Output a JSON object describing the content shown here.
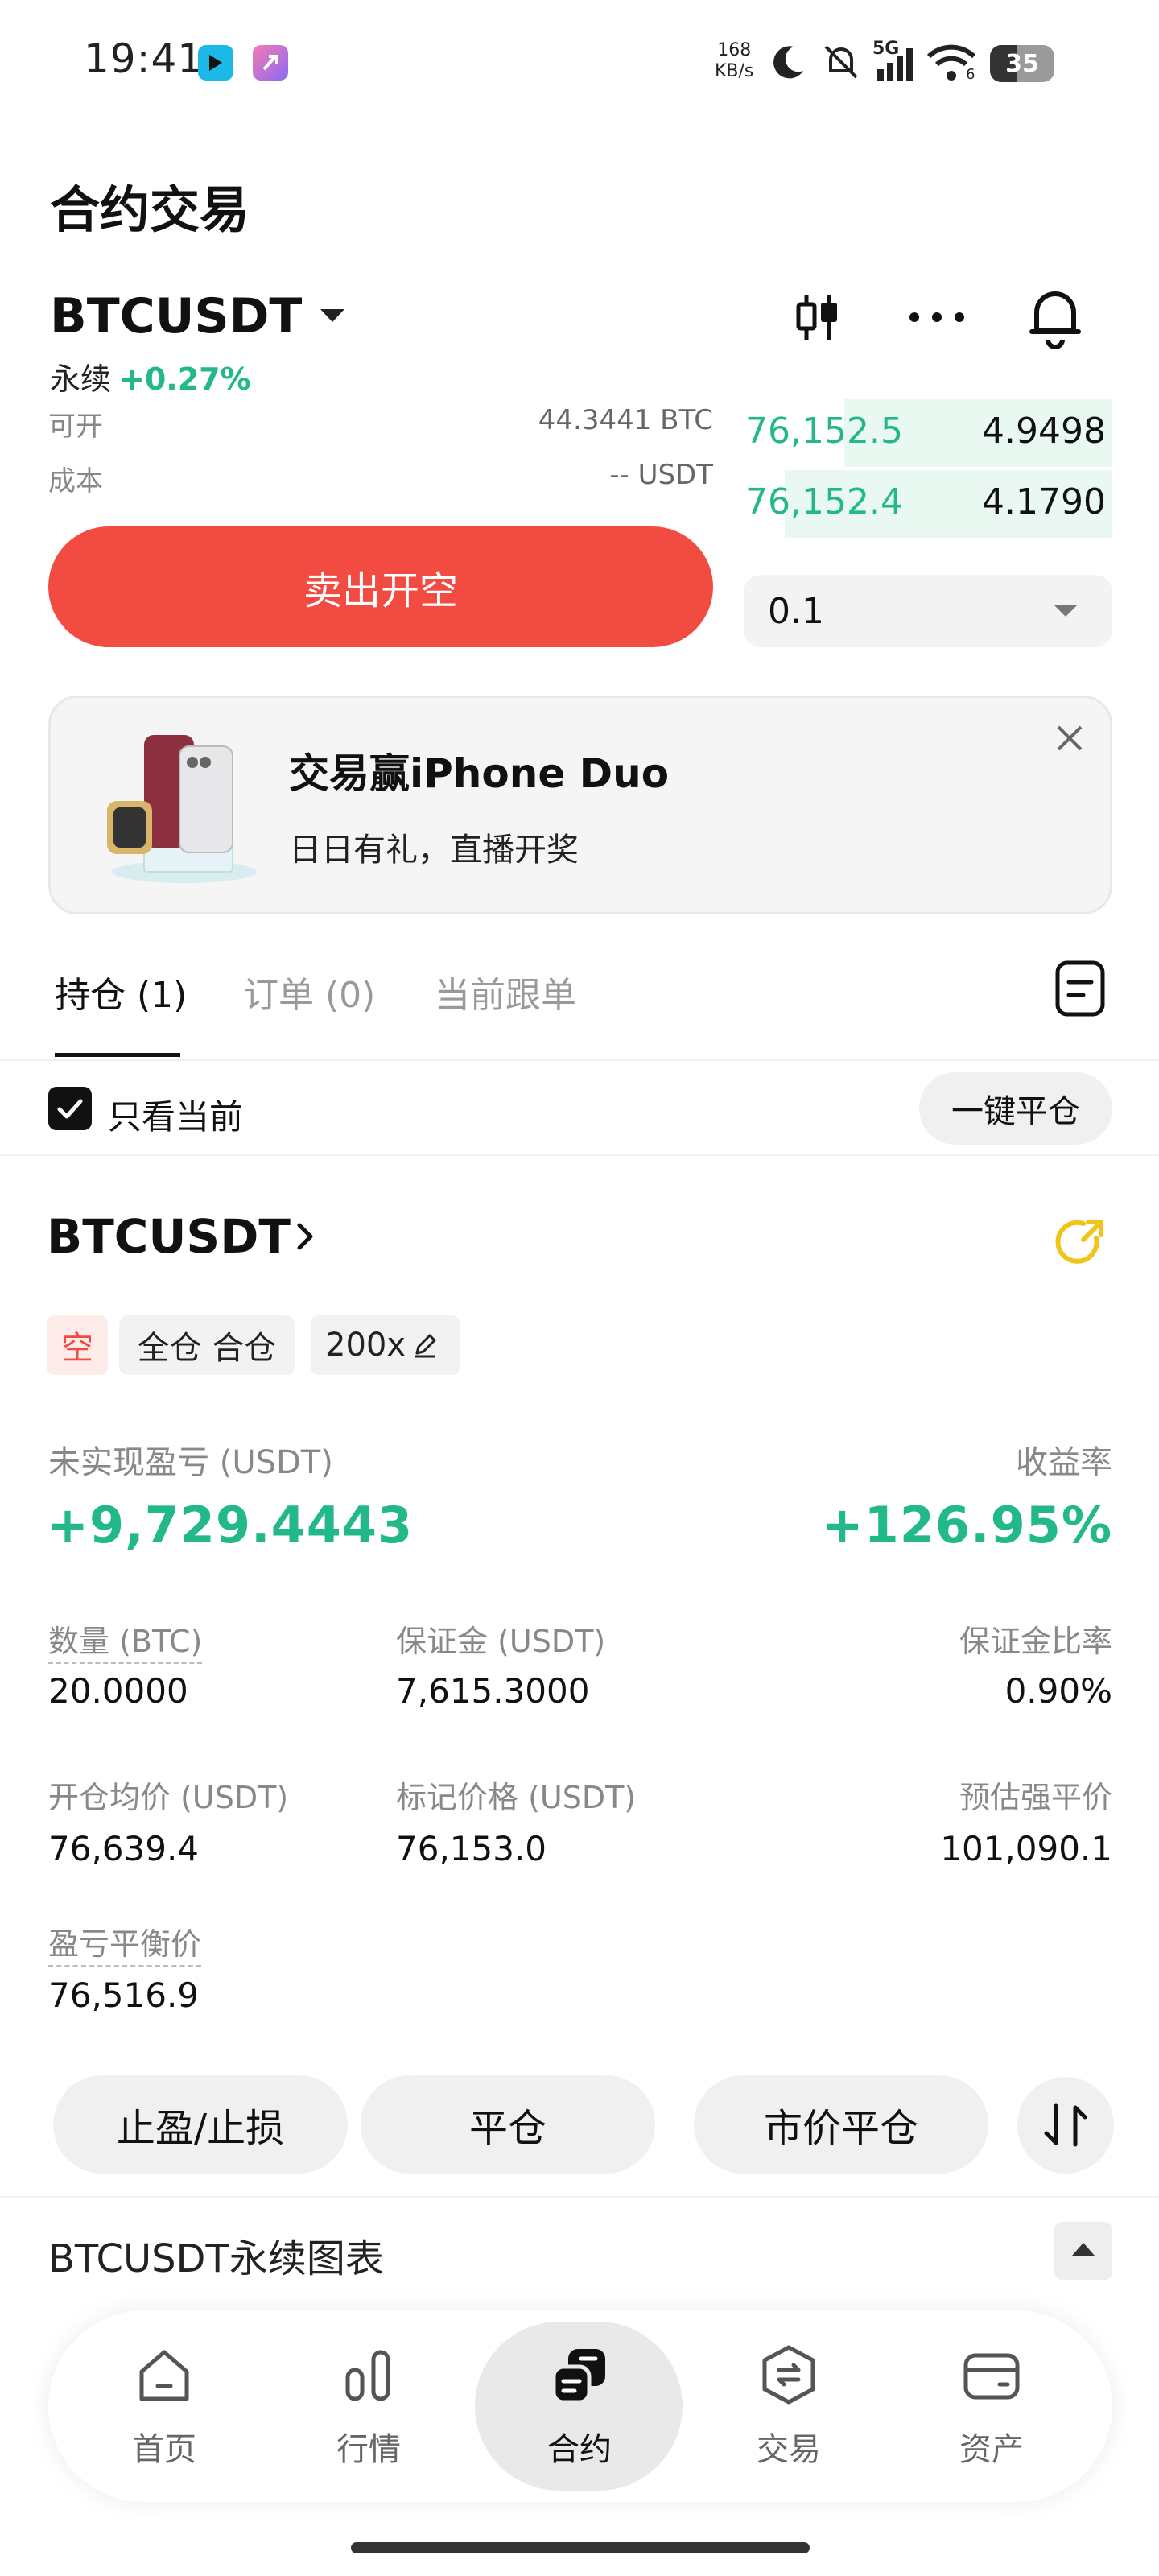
{
  "status_bar": {
    "time": "19:41",
    "net_speed_value": "168",
    "net_speed_unit": "KB/s",
    "network": "5G",
    "wifi_level": "6",
    "battery": "35"
  },
  "page": {
    "title": "合约交易"
  },
  "ticker": {
    "symbol": "BTCUSDT",
    "type": "永续",
    "change": "+0.27%",
    "available_label": "可开",
    "available_value": "44.3441 BTC",
    "cost_label": "成本",
    "cost_value": "-- USDT"
  },
  "orderbook": [
    {
      "price": "76,152.5",
      "qty": "4.9498",
      "depth": 0.72
    },
    {
      "price": "76,152.4",
      "qty": "4.1790",
      "depth": 0.88
    }
  ],
  "order": {
    "sell_label": "卖出开空",
    "qty_value": "0.1"
  },
  "banner": {
    "title": "交易赢iPhone Duo",
    "subtitle": "日日有礼，直播开奖"
  },
  "tabs": [
    {
      "label": "持仓 (1)"
    },
    {
      "label": "订单 (0)"
    },
    {
      "label": "当前跟单"
    }
  ],
  "filter": {
    "only_current_label": "只看当前",
    "only_current_checked": true,
    "close_all_label": "一键平仓"
  },
  "position": {
    "symbol": "BTCUSDT",
    "side_tag": "空",
    "margin_tag": "全仓 合仓",
    "leverage_tag": "200x",
    "pnl_label": "未实现盈亏 (USDT)",
    "pnl_value": "+9,729.4443",
    "roe_label": "收益率",
    "roe_value": "+126.95%",
    "fields": {
      "qty_label": "数量 (BTC)",
      "qty_value": "20.0000",
      "margin_label": "保证金 (USDT)",
      "margin_value": "7,615.3000",
      "margin_ratio_label": "保证金比率",
      "margin_ratio_value": "0.90%",
      "entry_label": "开仓均价 (USDT)",
      "entry_value": "76,639.4",
      "mark_label": "标记价格 (USDT)",
      "mark_value": "76,153.0",
      "liq_label": "预估强平价",
      "liq_value": "101,090.1",
      "breakeven_label": "盈亏平衡价",
      "breakeven_value": "76,516.9"
    },
    "actions": {
      "tpsl": "止盈/止损",
      "close": "平仓",
      "market_close": "市价平仓"
    }
  },
  "chart_section": {
    "title": "BTCUSDT永续图表"
  },
  "bottom_nav": [
    {
      "label": "首页",
      "icon": "home-icon"
    },
    {
      "label": "行情",
      "icon": "market-bars-icon"
    },
    {
      "label": "合约",
      "icon": "contract-icon",
      "active": true
    },
    {
      "label": "交易",
      "icon": "trade-exchange-icon"
    },
    {
      "label": "资产",
      "icon": "wallet-icon"
    }
  ],
  "colors": {
    "green": "#22b88a",
    "red": "#f24c42",
    "accent_yellow": "#f0c419"
  }
}
